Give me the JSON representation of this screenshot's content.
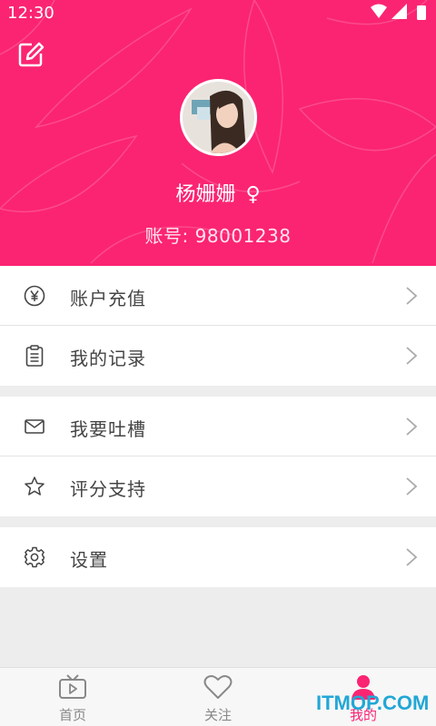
{
  "colors": {
    "brand": "#fb2472",
    "text": "#444444",
    "muted": "#888888",
    "divider": "#e3e3e3",
    "background": "#ededed"
  },
  "status_bar": {
    "time": "12:30",
    "icons": [
      "wifi-icon",
      "signal-icon",
      "battery-icon"
    ]
  },
  "header": {
    "edit_icon": "edit-icon",
    "username": "杨姗姗",
    "gender_symbol": "♀",
    "account_label": "账号:",
    "account_number": "98001238"
  },
  "menu": {
    "group1": [
      {
        "label": "账户充值",
        "icon": "yen-icon"
      },
      {
        "label": "我的记录",
        "icon": "clipboard-icon"
      }
    ],
    "group2": [
      {
        "label": "我要吐槽",
        "icon": "mail-icon"
      },
      {
        "label": "评分支持",
        "icon": "star-icon"
      }
    ],
    "group3": [
      {
        "label": "设置",
        "icon": "gear-icon"
      }
    ]
  },
  "tabs": [
    {
      "label": "首页",
      "icon": "tv-icon",
      "active": false
    },
    {
      "label": "关注",
      "icon": "heart-icon",
      "active": false
    },
    {
      "label": "我的",
      "icon": "person-icon",
      "active": true
    }
  ],
  "watermark": "ITMOP.COM"
}
